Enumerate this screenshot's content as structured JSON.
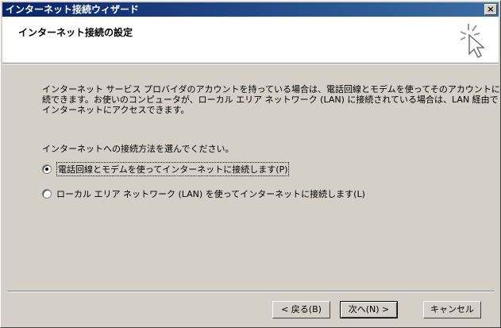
{
  "window": {
    "title": "インターネット接続ウィザード",
    "close_label": "×"
  },
  "header": {
    "title": "インターネット接続の設定",
    "icon": "wizard-cursor-icon"
  },
  "description": [
    "インターネット サービス プロバイダのアカウントを持っている場合は、電話回線とモデムを使ってそのアカウントに接",
    "続できます。お使いのコンピュータが、ローカル エリア ネットワーク (LAN) に接続されている場合は、LAN 経由で",
    "インターネットにアクセスできます。"
  ],
  "prompt": "インターネットへの接続方法を選んでください。",
  "options": [
    {
      "label": "電話回線とモデムを使ってインターネットに接続します(P)",
      "checked": true
    },
    {
      "label": "ローカル エリア ネットワーク (LAN) を使ってインターネットに接続します(L)",
      "checked": false
    }
  ],
  "buttons": {
    "back": "< 戻る(B)",
    "next": "次へ(N) >",
    "cancel": "キャンセル"
  }
}
